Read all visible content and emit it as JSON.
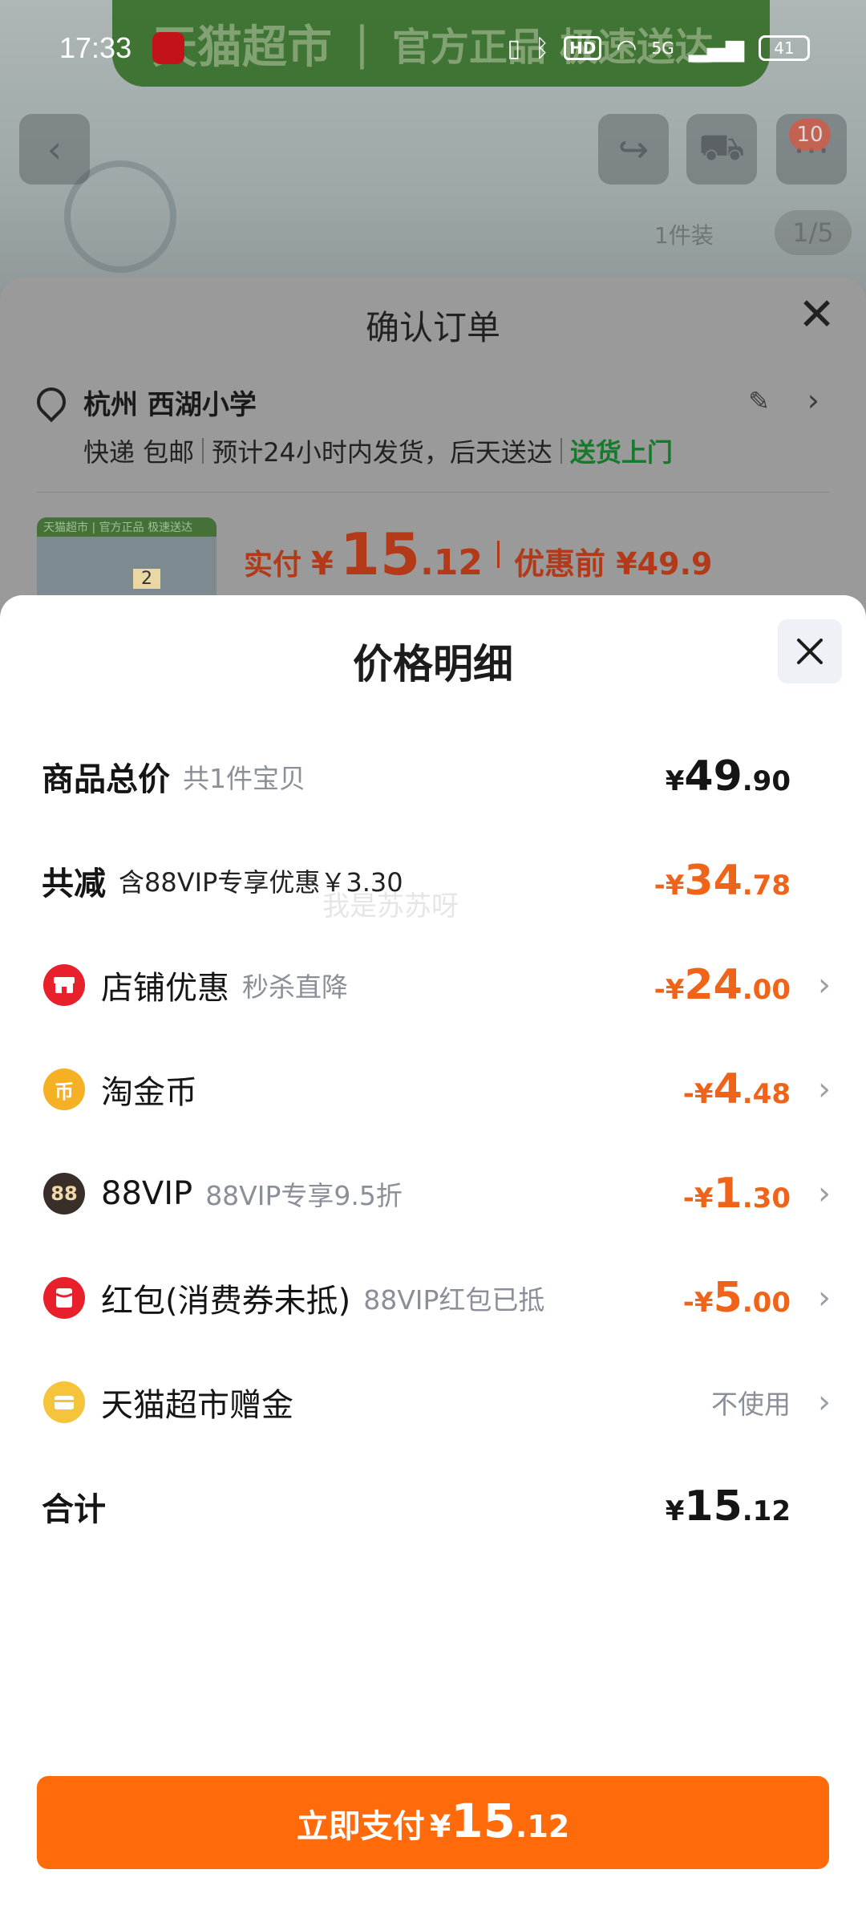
{
  "status_bar": {
    "time": "17:33",
    "network": "5G",
    "hd": "HD",
    "battery": "41"
  },
  "background_page": {
    "banner_brand": "天猫超市",
    "banner_slogan": "官方正品 极速送达",
    "cart_badge": "10",
    "image_counter": "1/5",
    "pack_label": "1件装"
  },
  "order_sheet": {
    "title": "确认订单",
    "address": "杭州 西湖小学",
    "shipping_method": "快递 包邮",
    "shipping_eta": "预计24小时内发货，后天送达",
    "delivery_tag": "送货上门",
    "thumb_strip": "天猫超市 | 官方正品 极速送达",
    "thumb_badge": "2",
    "paid_label": "实付",
    "paid_currency": "¥",
    "paid_int": "15",
    "paid_dec": ".12",
    "before_label": "优惠前 ¥49.9"
  },
  "price_detail": {
    "title": "价格明细",
    "watermark": "我是苏苏呀",
    "total_goods": {
      "label": "商品总价",
      "sub": "共1件宝贝",
      "currency": "¥",
      "int": "49",
      "dec": ".90"
    },
    "total_discount": {
      "label": "共减",
      "sub": "含88VIP专享优惠￥3.30",
      "currency": "-¥",
      "int": "34",
      "dec": ".78"
    },
    "items": [
      {
        "label": "店铺优惠",
        "sub": "秒杀直降",
        "currency": "-¥",
        "int": "24",
        "dec": ".00",
        "icon": "shop-icon"
      },
      {
        "label": "淘金币",
        "sub": "",
        "currency": "-¥",
        "int": "4",
        "dec": ".48",
        "icon": "coin-icon",
        "icon_glyph": "币"
      },
      {
        "label": "88VIP",
        "sub": "88VIP专享9.5折",
        "currency": "-¥",
        "int": "1",
        "dec": ".30",
        "icon": "vip-icon",
        "icon_glyph": "88"
      },
      {
        "label": "红包(消费券未抵)",
        "sub": "88VIP红包已抵",
        "currency": "-¥",
        "int": "5",
        "dec": ".00",
        "icon": "red-packet-icon"
      },
      {
        "label": "天猫超市赠金",
        "sub": "",
        "value_text": "不使用",
        "icon": "gift-card-icon"
      }
    ],
    "total": {
      "label": "合计",
      "currency": "¥",
      "int": "15",
      "dec": ".12"
    }
  },
  "pay_button": {
    "label": "立即支付",
    "currency": "¥",
    "int": "15",
    "dec": ".12"
  },
  "colors": {
    "accent_orange": "#ff6a0a",
    "discount_orange": "#f0641a",
    "green_tag": "#157a2b"
  }
}
